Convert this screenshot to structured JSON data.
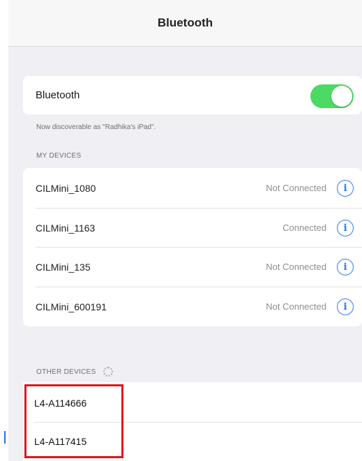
{
  "navbar": {
    "title": "Bluetooth"
  },
  "bluetooth": {
    "label": "Bluetooth",
    "enabled": true,
    "discoverable_note": "Now discoverable as \"Radhika's iPad\"."
  },
  "my_devices": {
    "header": "MY DEVICES",
    "items": [
      {
        "name": "CILMini_1080",
        "status": "Not Connected"
      },
      {
        "name": "CILMini_1163",
        "status": "Connected"
      },
      {
        "name": "CILMini_135",
        "status": "Not Connected"
      },
      {
        "name": "CILMini_600191",
        "status": "Not Connected"
      }
    ]
  },
  "other_devices": {
    "header": "OTHER DEVICES",
    "items": [
      {
        "name": "L4-A114666"
      },
      {
        "name": "L4-A117415"
      }
    ]
  },
  "colors": {
    "toggle_on": "#4cd964",
    "info_icon": "#2f7cf6",
    "highlight_box": "#e0141b"
  }
}
